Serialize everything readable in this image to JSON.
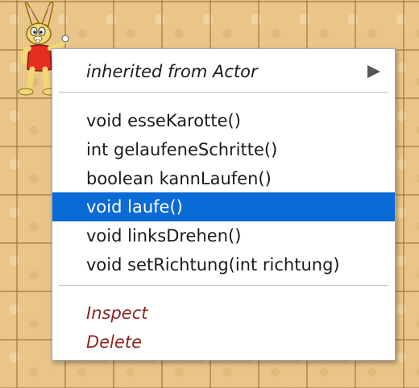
{
  "menu": {
    "inherited": {
      "label": "inherited from Actor",
      "icon": "triangle-right-icon"
    },
    "methods": [
      "void esseKarotte()",
      "int gelaufeneSchritte()",
      "boolean kannLaufen()",
      "void laufe()",
      "void linksDrehen()",
      "void setRichtung(int richtung)"
    ],
    "selected_index": 3,
    "actions": [
      "Inspect",
      "Delete"
    ]
  },
  "colors": {
    "selection": "#0a6ad6",
    "action_text": "#8e2420",
    "world_background": "#e9c58a"
  },
  "world": {
    "actor_icon": "rabbit-icon"
  }
}
